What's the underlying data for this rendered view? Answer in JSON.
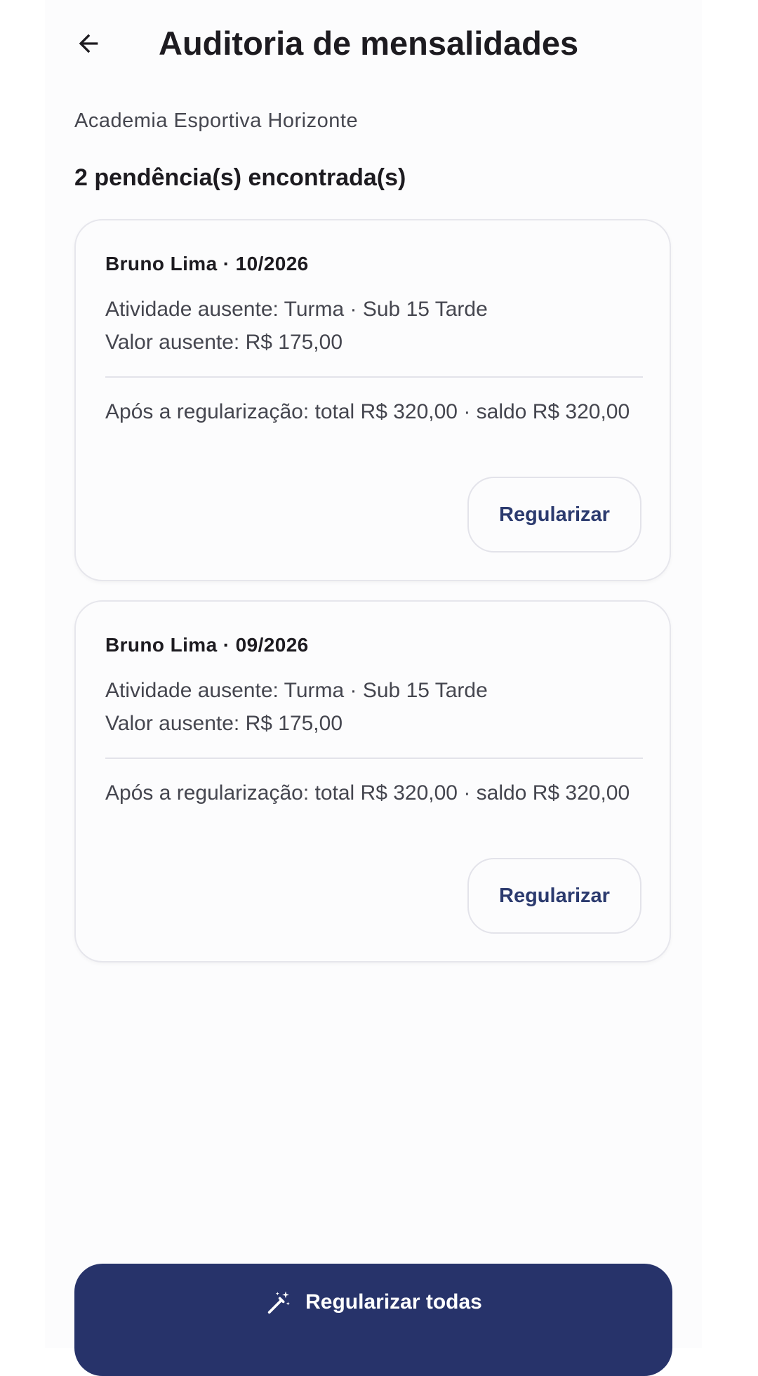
{
  "header": {
    "title": "Auditoria de mensalidades",
    "back_icon": "arrow-left-icon"
  },
  "academy_name": "Academia Esportiva Horizonte",
  "pending_count_text": "2 pendência(s) encontrada(s)",
  "cards": [
    {
      "title": "Bruno Lima · 10/2026",
      "activity": "Atividade ausente: Turma · Sub 15 Tarde",
      "value": "Valor ausente: R$ 175,00",
      "after": "Após a regularização: total R$ 320,00 · saldo R$ 320,00",
      "button_label": "Regularizar"
    },
    {
      "title": "Bruno Lima · 09/2026",
      "activity": "Atividade ausente: Turma · Sub 15 Tarde",
      "value": "Valor ausente: R$ 175,00",
      "after": "Após a regularização: total R$ 320,00 · saldo R$ 320,00",
      "button_label": "Regularizar"
    }
  ],
  "footer": {
    "button_label": "Regularizar todas",
    "icon": "magic-wand-icon"
  },
  "colors": {
    "primary": "#27336a",
    "button_text": "#2b3a6e",
    "background": "#fcfcfd"
  }
}
